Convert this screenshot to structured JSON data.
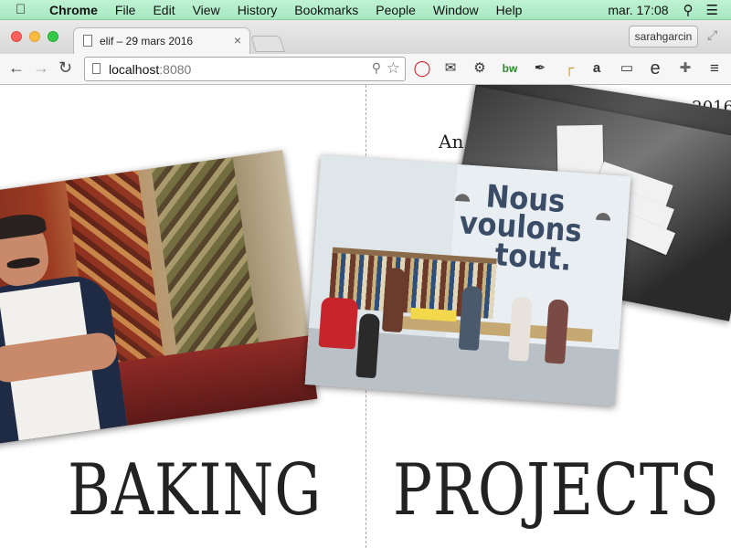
{
  "menubar": {
    "app": "Chrome",
    "items": [
      "File",
      "Edit",
      "View",
      "History",
      "Bookmarks",
      "People",
      "Window",
      "Help"
    ],
    "clock": "mar. 17:08"
  },
  "tabstrip": {
    "tab_title": "elif – 29 mars 2016",
    "user_button": "sarahgarcin"
  },
  "toolbar": {
    "url_host": "localhost",
    "url_port": ":8080",
    "extensions": [
      "opera-icon",
      "evernote-icon",
      "gear-icon",
      "bw-icon",
      "eyedropper-icon",
      "ruler-icon",
      "amazon-icon",
      "cast-icon",
      "e-icon",
      "puzzle-icon"
    ]
  },
  "page": {
    "left_headline": "BAKING",
    "right_headline": "PROJECTS",
    "side_text_top": "elif – 29 mars 2016",
    "side_text_mid": "An",
    "slogan": [
      "Nous",
      "voulons",
      "tout."
    ]
  }
}
